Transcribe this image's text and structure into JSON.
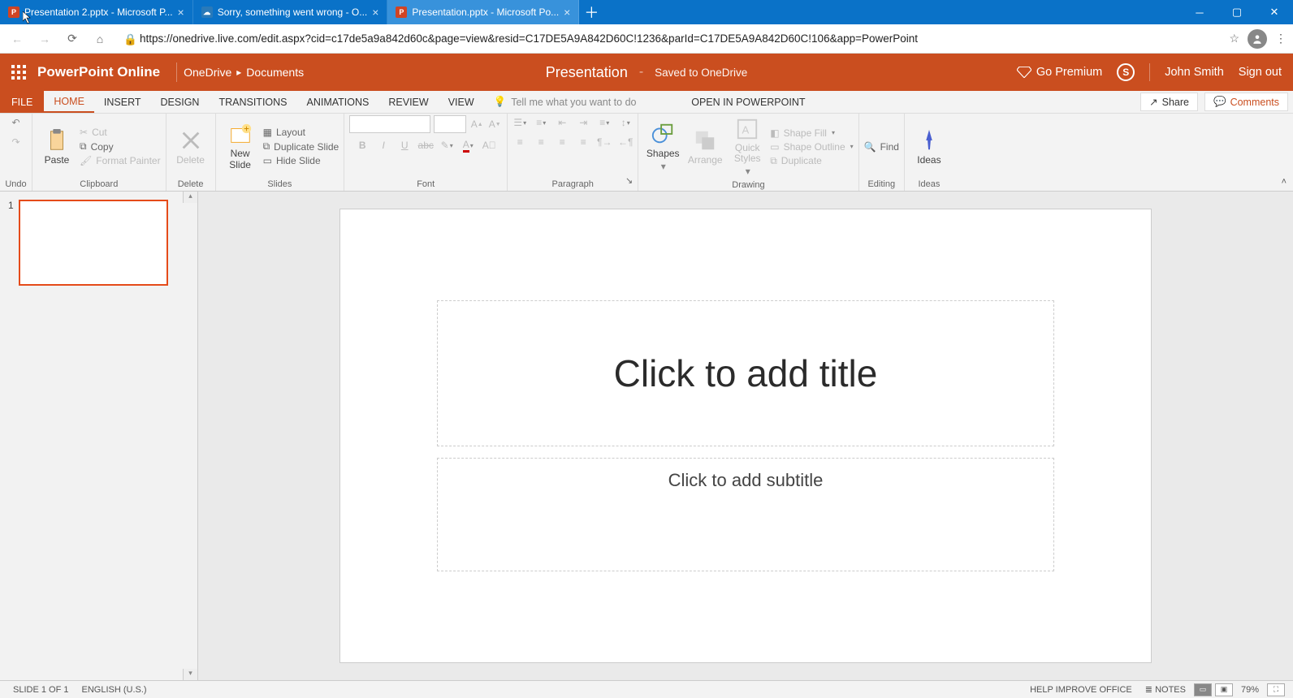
{
  "browser": {
    "tabs": [
      {
        "title": "Presentation 2.pptx - Microsoft P..."
      },
      {
        "title": "Sorry, something went wrong - O..."
      },
      {
        "title": "Presentation.pptx - Microsoft Po..."
      }
    ],
    "url": "https://onedrive.live.com/edit.aspx?cid=c17de5a9a842d60c&page=view&resid=C17DE5A9A842D60C!1236&parId=C17DE5A9A842D60C!106&app=PowerPoint"
  },
  "header": {
    "brand": "PowerPoint Online",
    "breadcrumb": [
      "OneDrive",
      "Documents"
    ],
    "doc_title": "Presentation",
    "save_state": "Saved to OneDrive",
    "premium": "Go Premium",
    "user_name": "John Smith",
    "signout": "Sign out"
  },
  "ribbon": {
    "tabs": [
      "FILE",
      "HOME",
      "INSERT",
      "DESIGN",
      "TRANSITIONS",
      "ANIMATIONS",
      "REVIEW",
      "VIEW"
    ],
    "tellme_placeholder": "Tell me what you want to do",
    "open_in": "OPEN IN POWERPOINT",
    "share": "Share",
    "comments": "Comments",
    "groups": {
      "undo": "Undo",
      "clipboard": {
        "paste": "Paste",
        "cut": "Cut",
        "copy": "Copy",
        "fmt": "Format Painter",
        "label": "Clipboard"
      },
      "delete": {
        "btn": "Delete",
        "label": "Delete"
      },
      "slides": {
        "new": "New Slide",
        "layout": "Layout",
        "dup": "Duplicate Slide",
        "hide": "Hide Slide",
        "label": "Slides"
      },
      "font": "Font",
      "paragraph": "Paragraph",
      "drawing": {
        "shapes": "Shapes",
        "arrange": "Arrange",
        "quick": "Quick Styles",
        "fill": "Shape Fill",
        "outline": "Shape Outline",
        "dup": "Duplicate",
        "label": "Drawing"
      },
      "editing": {
        "find": "Find",
        "label": "Editing"
      },
      "ideas": {
        "btn": "Ideas",
        "label": "Ideas"
      }
    }
  },
  "slide": {
    "num": "1",
    "title_placeholder": "Click to add title",
    "subtitle_placeholder": "Click to add subtitle"
  },
  "status": {
    "slide": "SLIDE 1 OF 1",
    "lang": "ENGLISH (U.S.)",
    "help": "HELP IMPROVE OFFICE",
    "notes": "NOTES",
    "zoom": "79%"
  }
}
